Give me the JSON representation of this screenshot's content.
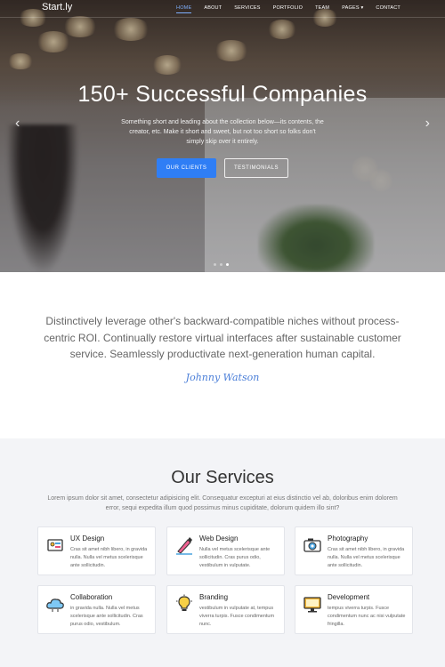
{
  "nav": {
    "brand": "Start.ly",
    "items": [
      {
        "label": "HOME",
        "active": true
      },
      {
        "label": "ABOUT"
      },
      {
        "label": "SERVICES"
      },
      {
        "label": "PORTFOLIO"
      },
      {
        "label": "TEAM"
      },
      {
        "label": "PAGES ▾"
      },
      {
        "label": "CONTACT"
      }
    ]
  },
  "hero": {
    "title": "150+ Successful Companies",
    "description": "Something short and leading about the collection below—its contents, the creator, etc. Make it short and sweet, but not too short so folks don't simply skip over it entirely.",
    "primary_button": "OUR CLIENTS",
    "secondary_button": "TESTIMONIALS",
    "prev_arrow": "‹",
    "next_arrow": "›"
  },
  "quote": {
    "text": "Distinctively leverage other's backward-compatible niches without process-centric ROI. Continually restore virtual interfaces after sustainable customer service. Seamlessly productivate next-generation human capital.",
    "signature": "Johnny Watson"
  },
  "services": {
    "title": "Our Services",
    "subtitle": "Lorem ipsum dolor sit amet, consectetur adipisicing elit. Consequatur excepturi at eius distinctio vel ab, doloribus enim dolorem error, sequi expedita illum quod possimus minus cupiditate, dolorum quidem illo sint?",
    "cards": [
      {
        "title": "UX Design",
        "desc": "Cras sit amet nibh libero, in gravida nulla. Nulla vel metus scelerisque ante sollicitudin.",
        "icon": "ux-design-icon"
      },
      {
        "title": "Web Design",
        "desc": "Nulla vel metus scelerisque ante sollicitudin. Cras purus odio, vestibulum in vulputate.",
        "icon": "web-design-icon"
      },
      {
        "title": "Photography",
        "desc": "Cras sit amet nibh libero, in gravida nulla. Nulla vel metus scelerisque ante sollicitudin.",
        "icon": "camera-icon"
      },
      {
        "title": "Collaboration",
        "desc": "in gravida nulla. Nulla vel metus scelerisque ante sollicitudin. Cras purus odio, vestibulum.",
        "icon": "cloud-icon"
      },
      {
        "title": "Branding",
        "desc": "vestibulum in vulputate at, tempus viverra turpis. Fusce condimentum nunc.",
        "icon": "lightbulb-icon"
      },
      {
        "title": "Development",
        "desc": "tempus viverra turpis. Fusce condimentum nunc ac nisi vulputate fringilla.",
        "icon": "monitor-icon"
      }
    ]
  }
}
